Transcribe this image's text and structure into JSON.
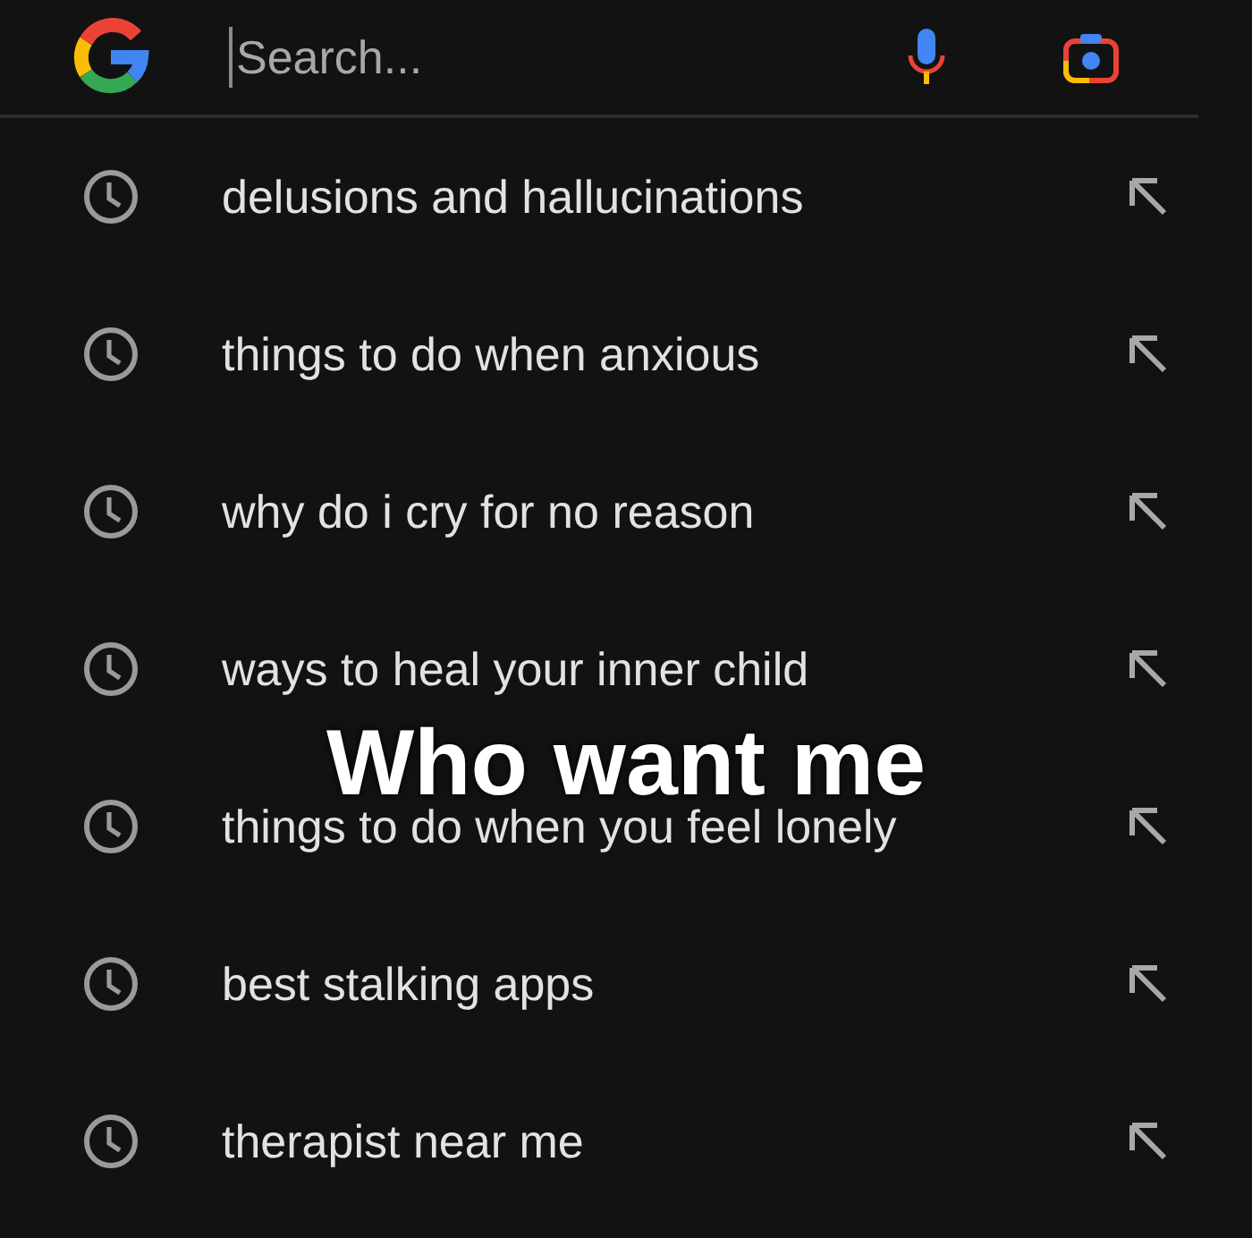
{
  "search": {
    "placeholder": "Search..."
  },
  "history": [
    {
      "text": "delusions and hallucinations"
    },
    {
      "text": "things to do when anxious"
    },
    {
      "text": "why do i cry for no reason"
    },
    {
      "text": "ways to heal your inner child"
    },
    {
      "text": "things to do when you feel lonely"
    },
    {
      "text": "best stalking apps"
    },
    {
      "text": "therapist near me"
    }
  ],
  "caption": "Who want me"
}
